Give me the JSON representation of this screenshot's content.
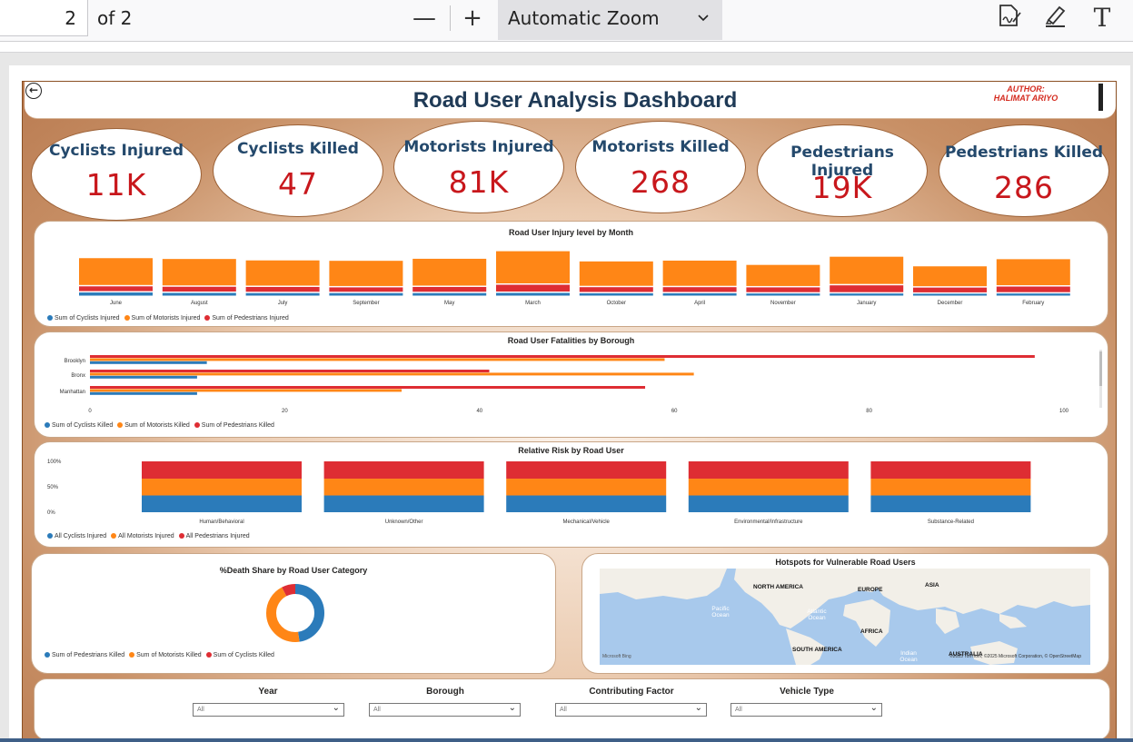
{
  "viewer": {
    "page_number": "2",
    "page_of": "of 2",
    "zoom": "Automatic Zoom",
    "zoom_out": "—",
    "zoom_in": "+",
    "chevron": "⌄",
    "text_tool": "T"
  },
  "dashboard": {
    "title": "Road User Analysis Dashboard",
    "author_line1": "AUTHOR:",
    "author_line2": "HALIMAT ARIYO"
  },
  "kpis": [
    {
      "label": "Cyclists Injured",
      "value": "11K"
    },
    {
      "label": "Cyclists Killed",
      "value": "47"
    },
    {
      "label": "Motorists Injured",
      "value": "81K"
    },
    {
      "label": "Motorists Killed",
      "value": "268"
    },
    {
      "label": "Pedestrians Injured",
      "value": "19K"
    },
    {
      "label": "Pedestrians Killed",
      "value": "286"
    }
  ],
  "colors": {
    "cyclists": "#2b7bba",
    "motorists": "#ff8616",
    "pedestrians": "#de2d33"
  },
  "chart_data": [
    {
      "type": "bar",
      "title": "Road User Injury level by Month",
      "categories": [
        "June",
        "August",
        "July",
        "September",
        "May",
        "March",
        "October",
        "April",
        "November",
        "January",
        "December",
        "February"
      ],
      "series": [
        {
          "name": "Sum of Cyclists Injured",
          "values": [
            1100,
            1000,
            950,
            950,
            950,
            1000,
            900,
            900,
            850,
            850,
            800,
            850
          ]
        },
        {
          "name": "Sum of Motorists Injured",
          "values": [
            6900,
            6800,
            6500,
            6500,
            6900,
            8200,
            6300,
            6500,
            5500,
            7000,
            5200,
            6700
          ]
        },
        {
          "name": "Sum of Pedestrians Injured",
          "values": [
            1500,
            1500,
            1500,
            1400,
            1500,
            2000,
            1500,
            1500,
            1500,
            2000,
            1500,
            1700
          ]
        }
      ],
      "legend": "bottom-left"
    },
    {
      "type": "bar",
      "orientation": "horizontal",
      "title": "Road User Fatalities by Borough",
      "categories": [
        "Brooklyn",
        "Bronx",
        "Manhattan"
      ],
      "series": [
        {
          "name": "Sum of Cyclists Killed",
          "values": [
            12,
            11,
            11
          ]
        },
        {
          "name": "Sum of Motorists Killed",
          "values": [
            59,
            62,
            32
          ]
        },
        {
          "name": "Sum of Pedestrians Killed",
          "values": [
            97,
            41,
            57
          ]
        }
      ],
      "x_ticks": [
        "0",
        "20",
        "40",
        "60",
        "80",
        "100"
      ],
      "xlim": [
        0,
        100
      ],
      "legend": "bottom-left"
    },
    {
      "type": "bar",
      "stacked": "percent",
      "title": "Relative Risk by Road User",
      "categories": [
        "Human/Behavioral",
        "Unknown/Other",
        "Mechanical/Vehicle",
        "Environmental/Infrastructure",
        "Substance-Related"
      ],
      "series": [
        {
          "name": "All Cyclists Injured",
          "values": [
            33,
            33,
            33,
            33,
            33
          ]
        },
        {
          "name": "All Motorists Injured",
          "values": [
            33,
            33,
            33,
            33,
            33
          ]
        },
        {
          "name": "All Pedestrians Injured",
          "values": [
            34,
            34,
            34,
            34,
            34
          ]
        }
      ],
      "y_ticks": [
        "100%",
        "50%",
        "0%"
      ],
      "legend": "bottom-left"
    },
    {
      "type": "pie",
      "donut": true,
      "title": "%Death Share by Road User Category",
      "labels": [
        "Sum of Pedestrians Killed",
        "Sum of Motorists Killed",
        "Sum of Cyclists Killed"
      ],
      "values": [
        286,
        268,
        47
      ],
      "legend": "bottom-left"
    }
  ],
  "map": {
    "title": "Hotspots for Vulnerable Road Users",
    "continents": [
      "NORTH AMERICA",
      "EUROPE",
      "ASIA",
      "AFRICA",
      "SOUTH AMERICA",
      "AUSTRALIA"
    ],
    "oceans": [
      "Pacific Ocean",
      "Atlantic Ocean",
      "Indian Ocean"
    ],
    "attribution": "©2025 TomTom, ©2025 Microsoft Corporation, © OpenStreetMap",
    "brand": "Microsoft Bing"
  },
  "slicers": [
    {
      "title": "Year",
      "value": "All"
    },
    {
      "title": "Borough",
      "value": "All"
    },
    {
      "title": "Contributing Factor",
      "value": "All"
    },
    {
      "title": "Vehicle Type",
      "value": "All"
    }
  ]
}
